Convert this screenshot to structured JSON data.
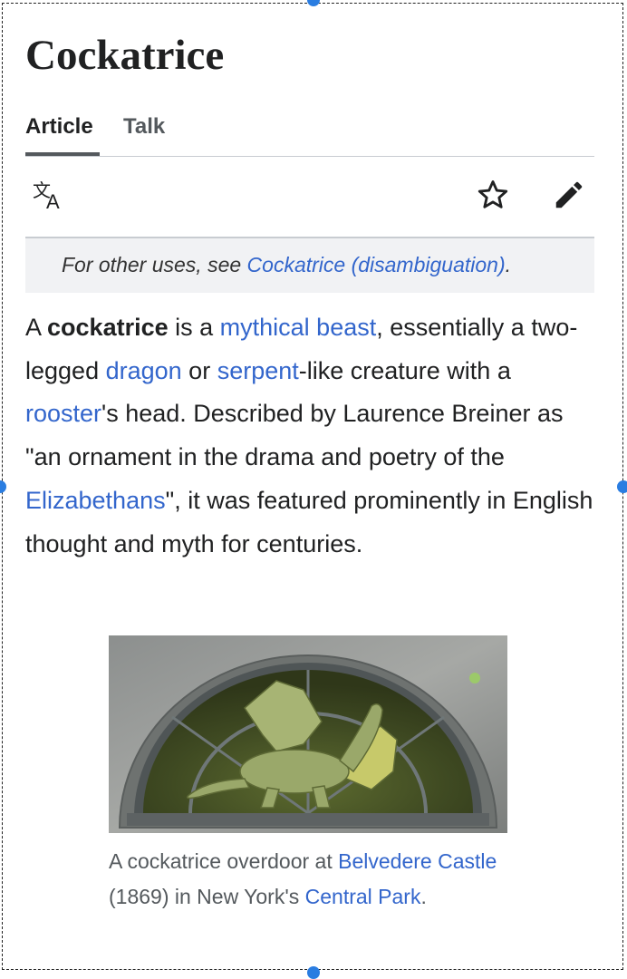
{
  "page": {
    "title": "Cockatrice"
  },
  "tabs": [
    {
      "label": "Article"
    },
    {
      "label": "Talk"
    }
  ],
  "toolbar": {
    "language_icon": "translate-icon",
    "watch_icon": "star-icon",
    "edit_icon": "pencil-icon"
  },
  "hatnote": {
    "prefix": "For other uses, see ",
    "link": "Cockatrice (disambiguation)",
    "suffix": "."
  },
  "intro": {
    "t1": "A ",
    "bold": "cockatrice",
    "t2": " is a ",
    "l1": "mythical beast",
    "t3": ", essentially a two-legged ",
    "l2": "dragon",
    "t4": " or ",
    "l3": "serpent",
    "t5": "-like creature with a ",
    "l4": "rooster",
    "t6": "'s head. Described by Laurence Breiner as \"an ornament in the drama and poetry of the ",
    "l5": "Elizabethans",
    "t7": "\", it was featured prominently in English thought and myth for centuries."
  },
  "figure": {
    "caption_t1": "A cockatrice overdoor at ",
    "caption_l1": "Belvedere Castle",
    "caption_t2": " (1869) in New York's ",
    "caption_l2": "Central Park",
    "caption_t3": "."
  },
  "colors": {
    "link": "#3366cc",
    "text": "#202122",
    "hatnote_bg": "#f1f2f4",
    "handle": "#2a7de1"
  }
}
